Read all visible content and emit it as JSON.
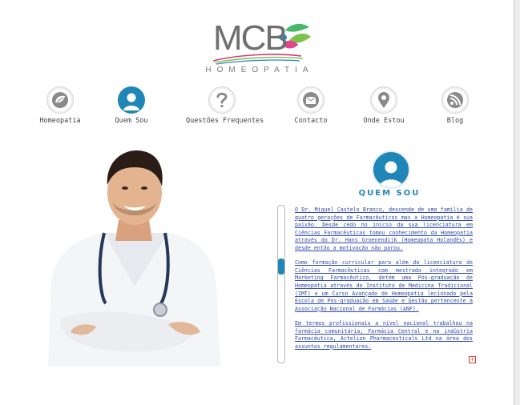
{
  "logo": {
    "brand": "MCB",
    "subtitle": "HOMEOPATIA"
  },
  "nav": {
    "items": [
      {
        "label": "Homeopatia",
        "icon": "leaf-icon"
      },
      {
        "label": "Quem Sou",
        "icon": "person-icon"
      },
      {
        "label": "Questões Frequentes",
        "icon": "question-icon"
      },
      {
        "label": "Contacto",
        "icon": "envelope-icon"
      },
      {
        "label": "Onde Estou",
        "icon": "map-pin-icon"
      },
      {
        "label": "Blog",
        "icon": "rss-icon"
      }
    ],
    "active_index": 1,
    "active_color": "#1f86b8"
  },
  "section": {
    "title": "QUEM SOU",
    "icon": "person-icon"
  },
  "article": {
    "paragraphs": [
      "O Dr. Miguel Castelo Branco, descende de uma família de quatro gerações de Farmacêuticos mas a Homeopatia é sua paixão. Desde cedo no início da sua licenciatura em Ciências Farmacêuticas tomou conhecimento da Homeopatia através do Dr. Hans Groenendijk (Homeopata Holandês) e desde então a motivação não parou.",
      "Como formação curricular para além da licenciatura de Ciências Farmacêuticas com mestrado integrado em Marketing Farmacêutico, detém uma Pós-graduação de Homeopatia através do Instituto de Medicina Tradicional (IMT) e um Curso Avançado de Homeopatia lecionado pela Escola de Pós-graduação em Saúde e Gestão pertencente à Associação Nacional de Farmácias (ANF).",
      "Em termos profissionais a nível nacional trabalhou na farmácia comunitária, Farmácia Central e na indústria Farmacêutica, Actelion Pharmaceuticals Ltd na área dos assuntos regulamentares."
    ],
    "more_icon": "plus-icon",
    "link_color": "#2f4aa8"
  },
  "colors": {
    "accent": "#1f86b8"
  }
}
